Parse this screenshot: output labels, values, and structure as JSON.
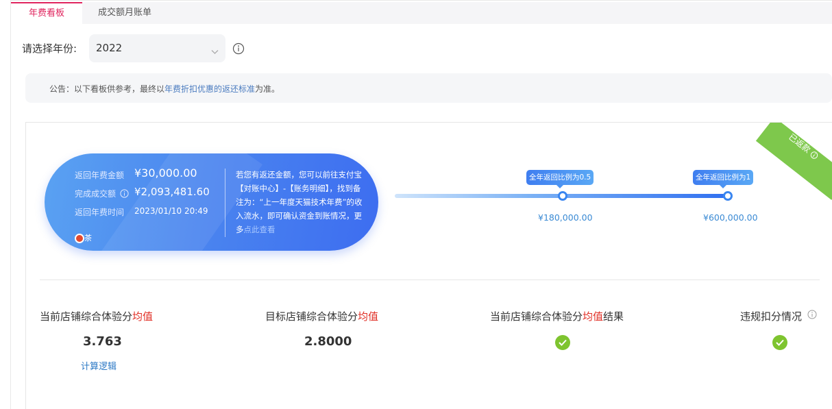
{
  "tabs": [
    {
      "label": "年费看板",
      "active": true
    },
    {
      "label": "成交额月账单",
      "active": false
    }
  ],
  "year_filter": {
    "label": "请选择年份:",
    "value": "2022"
  },
  "notice": {
    "prefix": "公告：以下看板供参考，最终以",
    "link": "年费折扣优惠的返还标准",
    "suffix": "为准。"
  },
  "status_ribbon": "已返款",
  "summary": {
    "rows": [
      {
        "label": "返回年费金额",
        "value": "¥30,000.00"
      },
      {
        "label": "完成成交额",
        "value": "¥2,093,481.60"
      },
      {
        "label": "返回年费时间",
        "value": "2023/01/10 20:49"
      }
    ],
    "message": "若您有返还金额，您可以前往支付宝【对账中心】-【账务明细】，找到备注为：“上一年度天猫技术年费”的收入流水，即可确认资金到账情况，更多",
    "message_link": "点此查看",
    "badge": "茶"
  },
  "progress": {
    "milestones": [
      {
        "bubble": "全年返回比例为0.5",
        "amount": "¥180,000.00"
      },
      {
        "bubble": "全年返回比例为1",
        "amount": "¥600,000.00"
      }
    ]
  },
  "metrics": [
    {
      "label_pre": "当前店铺综合体验分",
      "label_hl": "均值",
      "label_post": "",
      "value": "3.763",
      "link": "计算逻辑"
    },
    {
      "label_pre": "目标店铺综合体验分",
      "label_hl": "均值",
      "label_post": "",
      "value": "2.8000"
    },
    {
      "label_pre": "当前店铺综合体验分",
      "label_hl": "均值",
      "label_post": "结果",
      "status": "check"
    },
    {
      "label_pre": "违规扣分情况",
      "label_hl": "",
      "label_post": "",
      "status": "check"
    }
  ],
  "colors": {
    "accent": "#e0245e",
    "success": "#7ec42f",
    "primary": "#3d6df0",
    "link": "#2b78c5"
  }
}
